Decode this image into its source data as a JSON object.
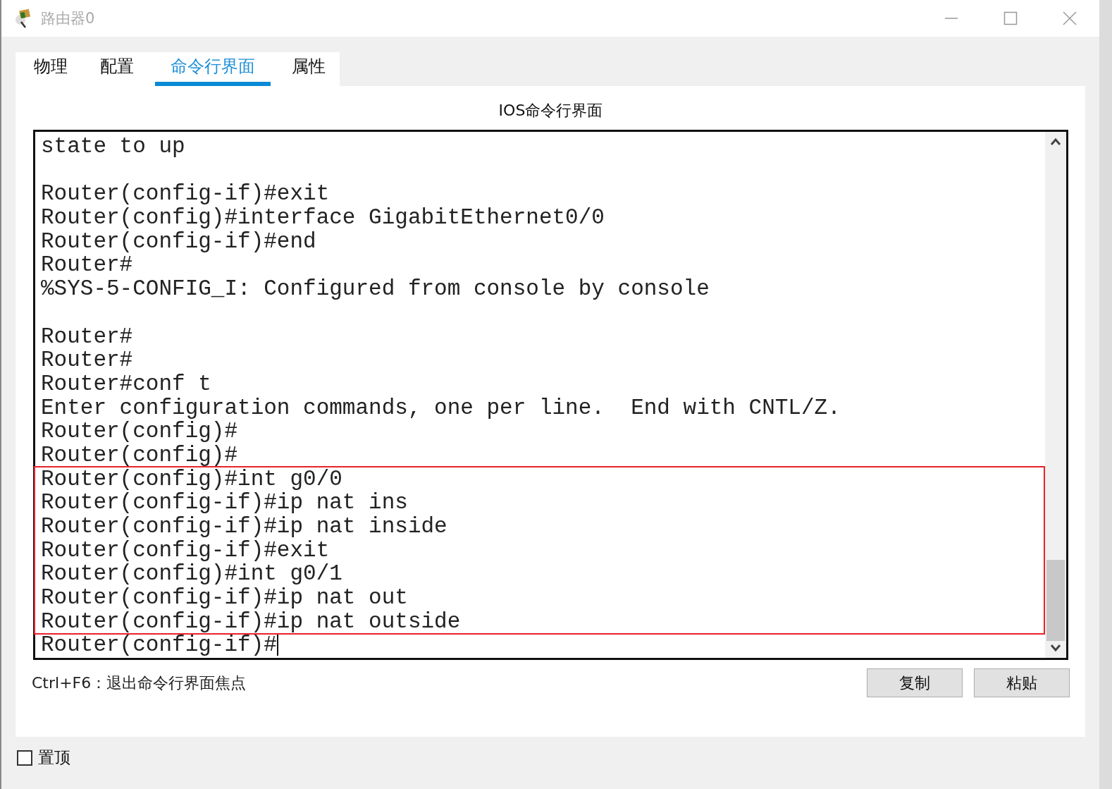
{
  "window": {
    "title": "路由器0"
  },
  "tabs": [
    {
      "label": "物理",
      "selected": false
    },
    {
      "label": "配置",
      "selected": false
    },
    {
      "label": "命令行界面",
      "selected": true
    },
    {
      "label": "属性",
      "selected": false
    }
  ],
  "panel_title": "IOS命令行界面",
  "console": {
    "paragraphs": [
      [
        "state to up"
      ],
      [
        "Router(config-if)#exit",
        "Router(config)#interface GigabitEthernet0/0",
        "Router(config-if)#end",
        "Router#",
        "%SYS-5-CONFIG_I: Configured from console by console"
      ],
      [
        "Router#",
        "Router#",
        "Router#conf t",
        "Enter configuration commands, one per line.  End with CNTL/Z.",
        "Router(config)#",
        "Router(config)#"
      ]
    ],
    "highlighted_lines": [
      "Router(config)#int g0/0",
      "Router(config-if)#ip nat ins",
      "Router(config-if)#ip nat inside",
      "Router(config-if)#exit",
      "Router(config)#int g0/1",
      "Router(config-if)#ip nat out",
      "Router(config-if)#ip nat outside"
    ],
    "prompt": "Router(config-if)#"
  },
  "hint": "Ctrl+F6：退出命令行界面焦点",
  "buttons": [
    "复制",
    "粘贴"
  ],
  "always_on_top": {
    "label": "置顶",
    "checked": false
  }
}
